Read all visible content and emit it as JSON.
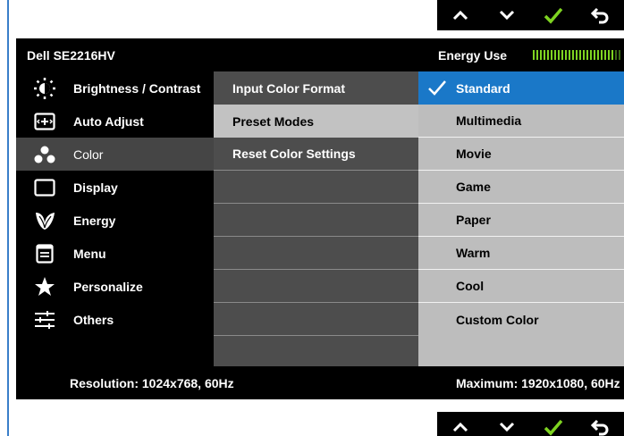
{
  "osd": {
    "model": "Dell SE2216HV",
    "energy_use_label": "Energy Use",
    "energy_level": 0.9,
    "accent_color": "#1a78c8",
    "check_color": "#7ed321"
  },
  "buttons": [
    {
      "icon": "chevron-up-icon"
    },
    {
      "icon": "chevron-down-icon"
    },
    {
      "icon": "check-icon"
    },
    {
      "icon": "back-arrow-icon"
    }
  ],
  "menu": [
    {
      "label": "Brightness / Contrast",
      "icon": "brightness-icon"
    },
    {
      "label": "Auto Adjust",
      "icon": "auto-adjust-icon"
    },
    {
      "label": "Color",
      "icon": "color-icon",
      "selected": true
    },
    {
      "label": "Display",
      "icon": "display-icon"
    },
    {
      "label": "Energy",
      "icon": "energy-leaf-icon"
    },
    {
      "label": "Menu",
      "icon": "menu-icon"
    },
    {
      "label": "Personalize",
      "icon": "star-icon"
    },
    {
      "label": "Others",
      "icon": "sliders-icon"
    }
  ],
  "submenu": [
    {
      "label": "Input Color Format"
    },
    {
      "label": "Preset Modes",
      "selected": true
    },
    {
      "label": "Reset Color Settings"
    }
  ],
  "presets": [
    {
      "label": "Standard",
      "selected": true
    },
    {
      "label": "Multimedia"
    },
    {
      "label": "Movie"
    },
    {
      "label": "Game"
    },
    {
      "label": "Paper"
    },
    {
      "label": "Warm"
    },
    {
      "label": "Cool"
    },
    {
      "label": "Custom Color"
    }
  ],
  "status": {
    "resolution": "Resolution: 1024x768, 60Hz",
    "maximum": "Maximum: 1920x1080, 60Hz"
  }
}
